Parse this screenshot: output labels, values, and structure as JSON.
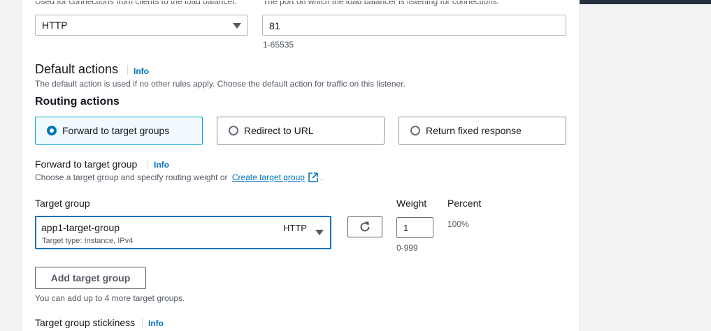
{
  "listener": {
    "protocol_hint": "Used for connections from clients to the load balancer.",
    "port_hint": "The port on which the load balancer is listening for connections.",
    "protocol_value": "HTTP",
    "port_value": "81",
    "port_range": "1-65535"
  },
  "default_actions": {
    "title": "Default actions",
    "info": "Info",
    "description": "The default action is used if no other rules apply. Choose the default action for traffic on this listener."
  },
  "routing_actions": {
    "title": "Routing actions",
    "options": [
      {
        "label": "Forward to target groups",
        "selected": true
      },
      {
        "label": "Redirect to URL",
        "selected": false
      },
      {
        "label": "Return fixed response",
        "selected": false
      }
    ]
  },
  "forward": {
    "title": "Forward to target group",
    "info": "Info",
    "description": "Choose a target group and specify routing weight or",
    "create_link": "Create target group",
    "period": "."
  },
  "target_group": {
    "label": "Target group",
    "weight_label": "Weight",
    "percent_label": "Percent",
    "selected_name": "app1-target-group",
    "selected_protocol": "HTTP",
    "selected_type": "Target type: Instance, IPv4",
    "weight_value": "1",
    "weight_range": "0-999",
    "percent_value": "100%"
  },
  "add_group": {
    "button_label": "Add target group",
    "hint": "You can add up to 4 more target groups."
  },
  "stickiness": {
    "title": "Target group stickiness",
    "info": "Info"
  },
  "colors": {
    "accent": "#0073bb",
    "selected_border": "#00a1c9",
    "selected_bg": "#f1faff"
  }
}
